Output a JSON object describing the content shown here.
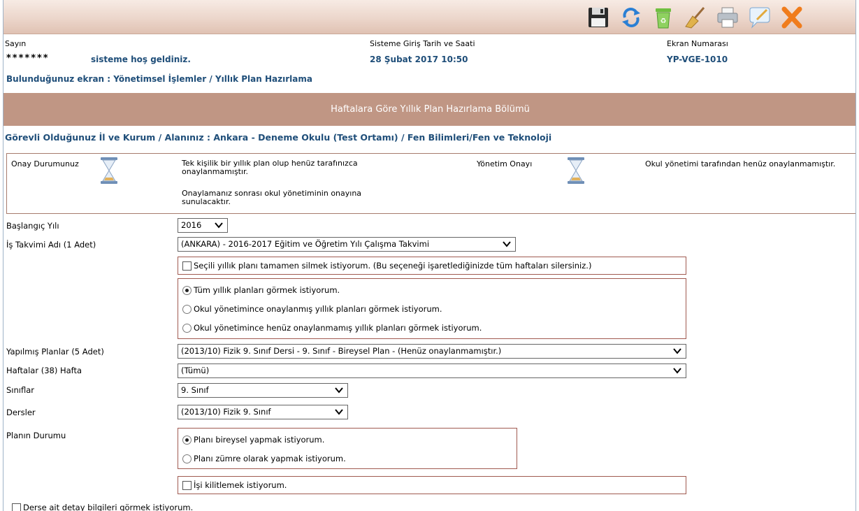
{
  "toolbar": {
    "icons": [
      "save-icon",
      "refresh-icon",
      "recycle-bin-icon",
      "broom-icon",
      "printer-icon",
      "comment-icon",
      "close-icon"
    ]
  },
  "header": {
    "greeting_label": "Sayın",
    "user_masked": "*******",
    "welcome": "sisteme hoş geldiniz.",
    "login_label": "Sisteme Giriş Tarih ve Saati",
    "login_value": "28 Şubat 2017 10:50",
    "screen_no_label": "Ekran Numarası",
    "screen_no_value": "YP-VGE-1010",
    "breadcrumb": "Bulunduğunuz ekran : Yönetimsel İşlemler / Yıllık Plan Hazırlama"
  },
  "section_title": "Haftalara Göre Yıllık Plan Hazırlama Bölümü",
  "duty": "Görevli Olduğunuz İl ve Kurum / Alanınız : Ankara - Deneme Okulu (Test Ortamı) / Fen Bilimleri/Fen ve Teknoloji",
  "status": {
    "own_label": "Onay Durumunuz",
    "own_text_1": "Tek kişilik bir yıllık plan olup henüz tarafınızca",
    "own_text_2": "onaylanmamıştır.",
    "own_text_3": "Onaylamanız sonrası okul yönetiminin onayına",
    "own_text_4": "sunulacaktır.",
    "admin_label": "Yönetim Onayı",
    "admin_text": "Okul yönetimi tarafından henüz onaylanmamıştır."
  },
  "form": {
    "start_year_label": "Başlangıç Yılı",
    "start_year_value": "2016",
    "calendar_label": "İş Takvimi Adı (1 Adet)",
    "calendar_value": "(ANKARA) - 2016-2017 Eğitim ve Öğretim Yılı Çalışma Takvimi",
    "delete_option": "Seçili yıllık planı tamamen silmek istiyorum. (Bu seçeneği işaretlediğinizde tüm haftaları silersiniz.)",
    "view_options": [
      "Tüm yıllık planları görmek istiyorum.",
      "Okul yönetimince onaylanmış yıllık planları görmek istiyorum.",
      "Okul yönetimince henüz onaylanmamış yıllık planları görmek istiyorum."
    ],
    "view_selected": 0,
    "plans_label": "Yapılmış Planlar (5 Adet)",
    "plans_value": "(2013/10) Fizik 9. Sınıf Dersi - 9. Sınıf - Bireysel Plan - (Henüz onaylanmamıştır.)",
    "weeks_label": "Haftalar (38) Hafta",
    "weeks_value": "(Tümü)",
    "classes_label": "Sınıflar",
    "classes_value": "9. Sınıf",
    "lessons_label": "Dersler",
    "lessons_value": "(2013/10) Fizik 9. Sınıf",
    "plan_status_label": "Planın Durumu",
    "plan_status_options": [
      "Planı bireysel yapmak istiyorum.",
      "Planı zümre olarak yapmak istiyorum."
    ],
    "plan_status_selected": 0,
    "lock_option": "İşi kilitlemek istiyorum.",
    "detail_option": "Derse ait detay bilgileri görmek istiyorum."
  }
}
